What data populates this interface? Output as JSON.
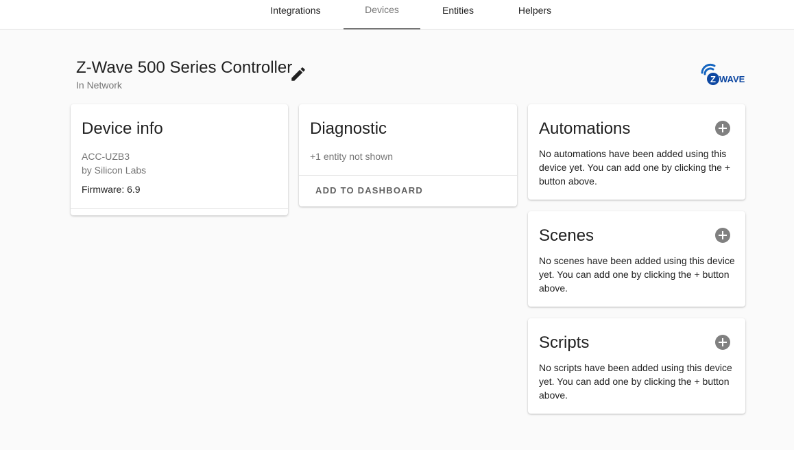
{
  "tabs": [
    {
      "label": "Integrations",
      "active": false
    },
    {
      "label": "Devices",
      "active": true
    },
    {
      "label": "Entities",
      "active": false
    },
    {
      "label": "Helpers",
      "active": false
    }
  ],
  "device": {
    "name": "Z-Wave 500 Series Controller",
    "area": "In Network",
    "brand_logo": "Z-WAVE",
    "edit_icon": "pencil-icon"
  },
  "device_info": {
    "title": "Device info",
    "model": "ACC-UZB3",
    "manufacturer": "by Silicon Labs",
    "firmware": "Firmware: 6.9"
  },
  "diagnostic": {
    "title": "Diagnostic",
    "hidden_entities": "+1 entity not shown",
    "add_to_dashboard": "ADD TO DASHBOARD"
  },
  "automations": {
    "title": "Automations",
    "empty_text": "No automations have been added using this device yet. You can add one by clicking the + button above.",
    "add_icon": "plus-circle-icon"
  },
  "scenes": {
    "title": "Scenes",
    "empty_text": "No scenes have been added using this device yet. You can add one by clicking the + button above.",
    "add_icon": "plus-circle-icon"
  },
  "scripts": {
    "title": "Scripts",
    "empty_text": "No scripts have been added using this device yet. You can add one by clicking the + button above.",
    "add_icon": "plus-circle-icon"
  },
  "colors": {
    "background": "#fafafa",
    "card": "#ffffff",
    "primary_text": "#212121",
    "secondary_text": "#757575",
    "zwave_brand": "#1565c0",
    "add_button": "#808080"
  }
}
